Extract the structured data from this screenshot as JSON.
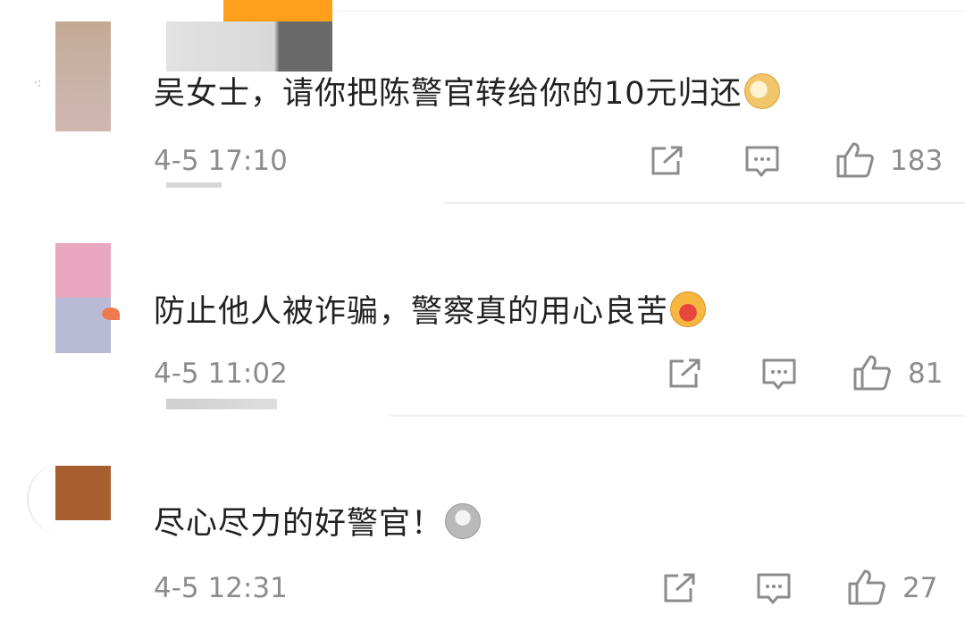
{
  "comments": [
    {
      "text": "吴女士，请你把陈警官转给你的10元归还",
      "emoji": "doge-emoji",
      "time": "4-5 17:10",
      "likes": "183",
      "avatar_colors": [
        "#c2a894",
        "#cfb7ad"
      ]
    },
    {
      "text": "防止他人被诈骗，警察真的用心良苦",
      "emoji": "heart-hug-emoji",
      "time": "4-5 11:02",
      "likes": "81",
      "avatar_colors": [
        "#e9a7c0",
        "#b9bbd6"
      ]
    },
    {
      "text": "尽心尽力的好警官！",
      "emoji": "ultraman-emoji",
      "time": "4-5 12:31",
      "likes": "27",
      "avatar_colors": [
        "#a85f2f",
        "#a85f2f"
      ]
    }
  ],
  "icons": {
    "share": "share-icon",
    "reply": "reply-icon",
    "like": "thumbs-up-icon"
  },
  "colors": {
    "text": "#222222",
    "meta": "#8c8c8c",
    "top_bar": "#ff9f1c"
  }
}
